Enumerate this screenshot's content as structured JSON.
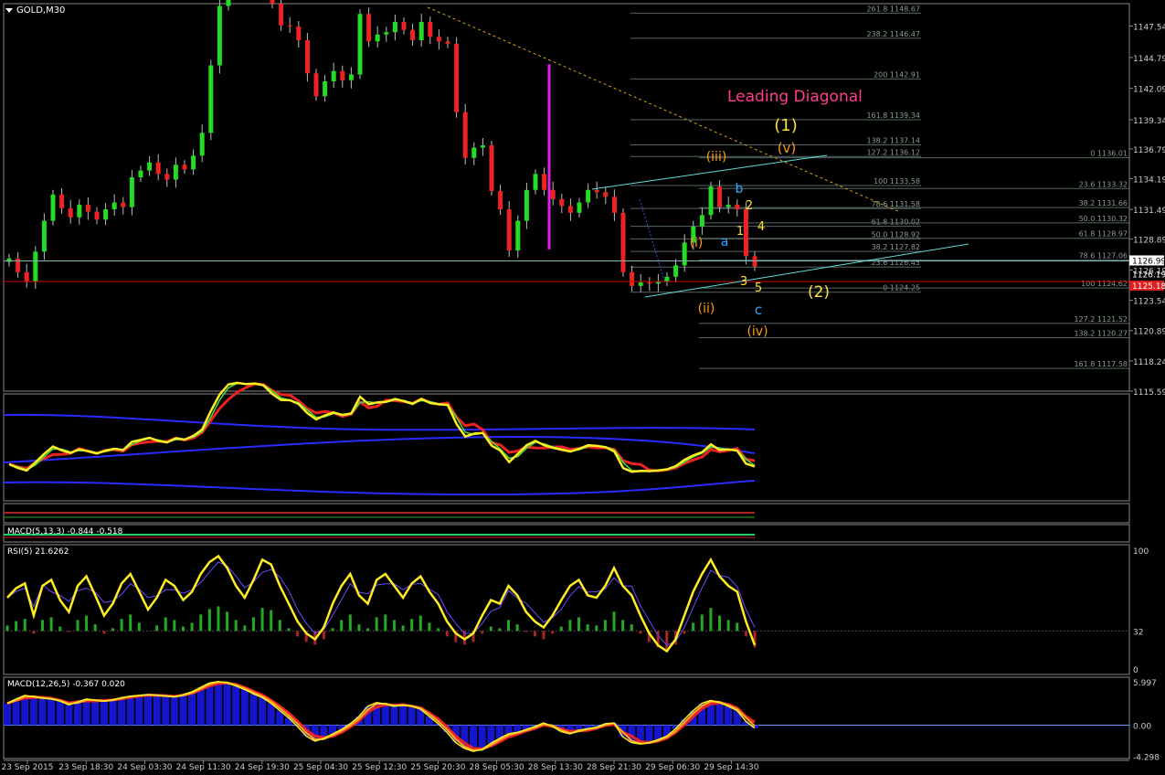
{
  "window": {
    "symbol_label": "GOLD,M30",
    "collapse_icon": "triangle-down-icon"
  },
  "colors": {
    "background": "#000000",
    "bull": "#22dd22",
    "bear": "#ee2222",
    "wick": "#cccccc",
    "fib": "#b8c4c4",
    "channel": "#5fdada",
    "downtrend": "#d4a017",
    "label_yellow": "#ffe033",
    "label_orange": "#ff9a1f",
    "label_blue": "#33a6ff",
    "title_pink": "#ff3d8b",
    "price_line": "#7fb6b6",
    "red_line": "#cc0000",
    "magenta": "#e020e0"
  },
  "main_chart": {
    "price_axis": [
      "1147.54",
      "1144.79",
      "1142.09",
      "1139.34",
      "1136.79",
      "1134.19",
      "1131.49",
      "1128.89",
      "1126.19",
      "1123.54",
      "1120.89",
      "1118.24",
      "1115.59"
    ],
    "current_price": "1126.99",
    "current_price_bid": "1126.19",
    "red_level_tag": "1125.18",
    "annotation_title": "Leading Diagonal",
    "wave_labels": {
      "one_major": "(1)",
      "two_major": "(2)",
      "i": "(i)",
      "ii": "(ii)",
      "iii": "(iii)",
      "iv": "(iv)",
      "v": "(v)",
      "a": "a",
      "b": "b",
      "c": "c",
      "n1": "1",
      "n2": "2",
      "n3": "3",
      "n4": "4",
      "n5": "5"
    },
    "fib_a_labels": [
      "261.8 1148.67",
      "238.2 1146.47",
      "200 1142.91",
      "161.8 1139.34",
      "138.2 1137.14",
      "127.2 1136.12",
      "100 1133.58",
      "78.6 1131.58",
      "61.8 1130.02",
      "50.0 1128.92",
      "38.2 1127.82",
      "23.6 1126.45",
      "0 1124.25"
    ],
    "fib_b_labels": [
      "0 1136.01",
      "23.6 1133.32",
      "38.2 1131.66",
      "50.0 1130.32",
      "61.8 1128.97",
      "78.6 1127.06",
      "100 1124.62",
      "127.2 1121.52",
      "138.2 1120.27",
      "161.8 1117.58"
    ]
  },
  "chart_data": {
    "type": "candlestick",
    "title": "GOLD,M30",
    "x_tick_labels": [
      "23 Sep 2015",
      "23 Sep 18:30",
      "24 Sep 03:30",
      "24 Sep 11:30",
      "24 Sep 19:30",
      "25 Sep 04:30",
      "25 Sep 12:30",
      "25 Sep 20:30",
      "28 Sep 05:30",
      "28 Sep 13:30",
      "28 Sep 21:30",
      "29 Sep 06:30",
      "29 Sep 14:30"
    ],
    "ylim": [
      1115.59,
      1149.5
    ],
    "close_path": [
      1127.2,
      1126.0,
      1125.2,
      1127.8,
      1130.5,
      1132.8,
      1131.6,
      1130.8,
      1131.9,
      1131.3,
      1130.6,
      1131.5,
      1132.1,
      1131.7,
      1134.3,
      1134.9,
      1135.6,
      1134.6,
      1134.1,
      1135.4,
      1135.0,
      1136.2,
      1138.2,
      1144.1,
      1149.3,
      1152.5,
      1153.0,
      1152.6,
      1152.8,
      1152.2,
      1149.5,
      1147.6,
      1147.5,
      1146.3,
      1143.4,
      1141.4,
      1142.7,
      1143.6,
      1142.8,
      1143.3,
      1148.6,
      1146.2,
      1146.8,
      1147.0,
      1147.9,
      1147.2,
      1146.3,
      1147.9,
      1146.6,
      1146.2,
      1146.0,
      1140.0,
      1136.0,
      1136.9,
      1137.1,
      1133.1,
      1131.5,
      1127.9,
      1130.5,
      1133.2,
      1134.6,
      1133.2,
      1132.4,
      1131.8,
      1131.2,
      1132.1,
      1133.2,
      1133.0,
      1132.6,
      1131.2,
      1126.0,
      1124.8,
      1125.1,
      1125.0,
      1125.2,
      1125.6,
      1126.6,
      1128.6,
      1130.0,
      1131.0,
      1133.5,
      1131.7,
      1131.9,
      1131.5,
      1127.4,
      1126.5
    ],
    "macd_small": {
      "label": "MACD(5,13,3) -0.844 -0.518"
    },
    "rsi": {
      "label": "RSI(5) 21.6262",
      "ylim": [
        0,
        100
      ],
      "axis_labels": [
        "100",
        "32",
        "0"
      ],
      "values": [
        60,
        68,
        72,
        45,
        70,
        75,
        58,
        48,
        70,
        78,
        62,
        45,
        55,
        72,
        80,
        65,
        50,
        60,
        75,
        70,
        58,
        65,
        80,
        90,
        95,
        85,
        70,
        60,
        75,
        92,
        88,
        70,
        55,
        40,
        30,
        25,
        35,
        55,
        70,
        80,
        62,
        55,
        75,
        80,
        70,
        60,
        72,
        78,
        65,
        55,
        40,
        30,
        25,
        30,
        45,
        58,
        55,
        70,
        62,
        48,
        40,
        35,
        45,
        58,
        70,
        75,
        62,
        60,
        70,
        85,
        70,
        62,
        45,
        30,
        20,
        15,
        25,
        45,
        65,
        80,
        92,
        78,
        70,
        65,
        40,
        20
      ]
    },
    "macd": {
      "label": "MACD(12,26,5) -0.367 0.020",
      "ylim": [
        -4.6,
        6.6
      ],
      "axis_labels": [
        "5.997",
        "0.00",
        "-4.298"
      ],
      "values": [
        3.0,
        3.6,
        4.1,
        3.9,
        3.7,
        3.6,
        3.3,
        2.8,
        3.2,
        3.6,
        3.4,
        3.3,
        3.5,
        3.8,
        4.0,
        4.1,
        4.2,
        4.1,
        4.0,
        3.9,
        4.2,
        4.6,
        5.2,
        5.8,
        6.0,
        5.8,
        5.4,
        4.9,
        4.3,
        3.8,
        3.0,
        2.0,
        1.0,
        -0.2,
        -1.5,
        -2.2,
        -1.8,
        -1.2,
        -0.6,
        0.2,
        1.2,
        2.6,
        3.1,
        2.9,
        2.6,
        2.8,
        2.6,
        2.2,
        1.2,
        0.2,
        -1.0,
        -2.4,
        -3.2,
        -3.6,
        -3.3,
        -2.5,
        -1.8,
        -1.2,
        -1.0,
        -0.6,
        -0.2,
        0.3,
        -0.2,
        -0.9,
        -1.2,
        -0.7,
        -0.5,
        -0.3,
        0.2,
        0.3,
        -1.6,
        -2.4,
        -2.6,
        -2.4,
        -2.0,
        -1.5,
        -0.5,
        0.8,
        2.0,
        3.0,
        3.4,
        3.1,
        2.6,
        2.0,
        0.5,
        -0.4
      ]
    }
  }
}
